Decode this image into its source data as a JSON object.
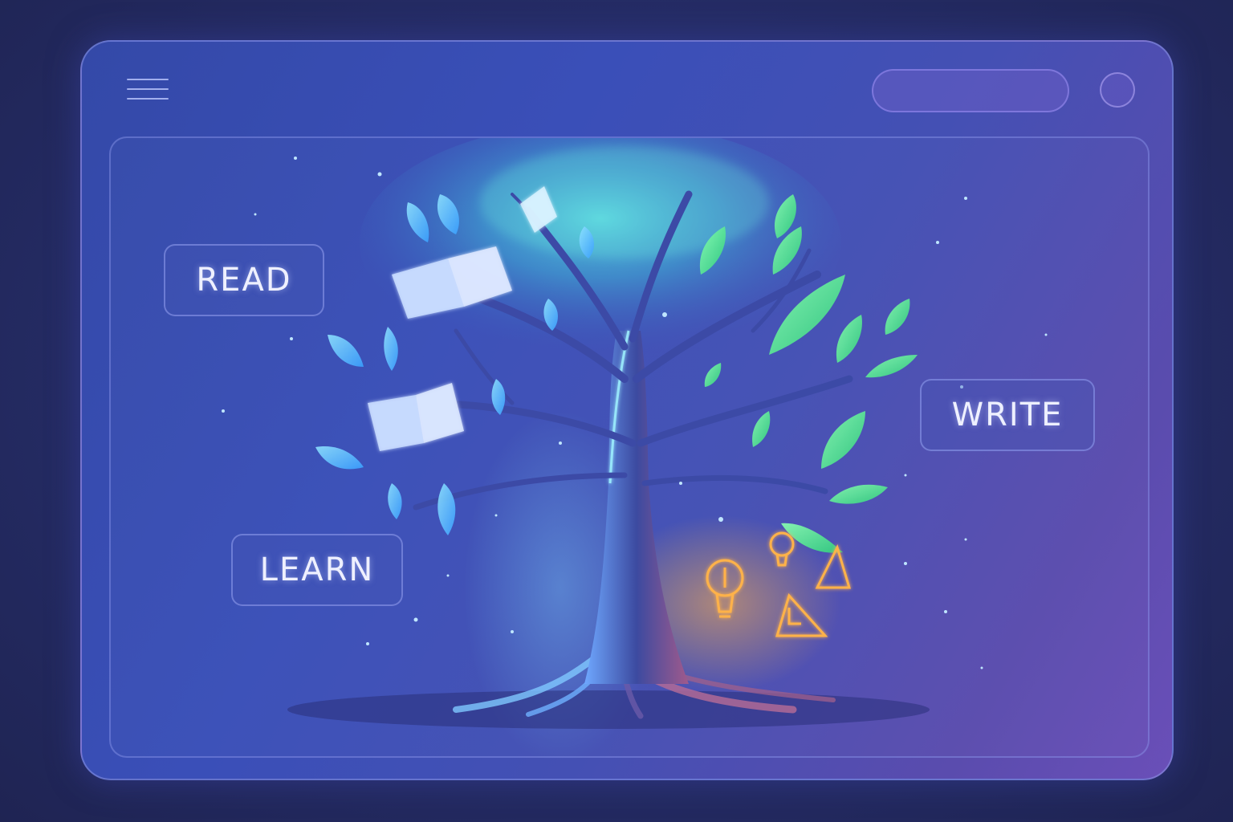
{
  "header": {
    "menu_icon": "hamburger-menu-icon",
    "search_field": "empty pill",
    "profile_icon": "circle-avatar-icon"
  },
  "hero": {
    "illustration": "glowing-knowledge-tree",
    "labels": {
      "read": "READ",
      "learn": "LEARN",
      "write": "WRITE"
    },
    "icons": [
      "open-book-icon",
      "paper-page-icon",
      "lightbulb-icon",
      "triangle-ruler-icon",
      "leaf-icon"
    ]
  },
  "colors": {
    "background": "#232958",
    "window_start": "#3449a8",
    "window_end": "#6a4fb8",
    "leaf_blue": "#4fc3ff",
    "leaf_green": "#4fe08a",
    "glow_orange": "#ffb24a",
    "text": "#eef0ff"
  }
}
